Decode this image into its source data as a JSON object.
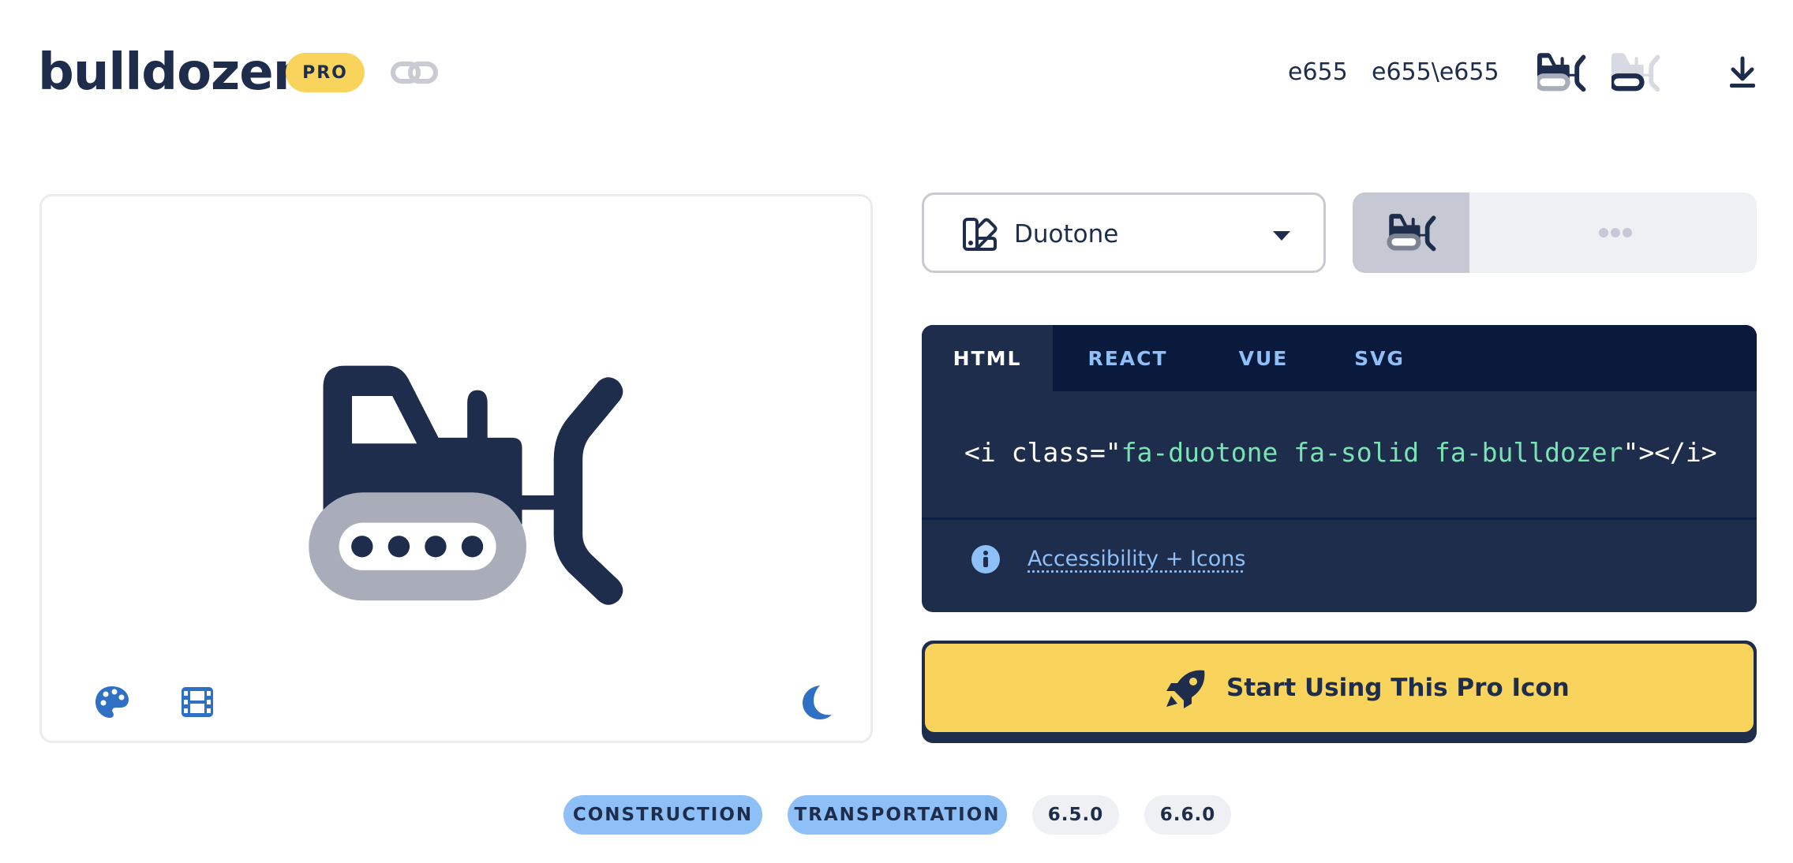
{
  "header": {
    "title": "bulldozer",
    "badge": "PRO",
    "unicode": "e655",
    "unicode_double": "e655\\e655"
  },
  "style_select": {
    "selected": "Duotone"
  },
  "code": {
    "tabs": [
      "HTML",
      "REACT",
      "VUE",
      "SVG"
    ],
    "active_tab": "HTML",
    "prefix": "<i class=\"",
    "classes": "fa-duotone fa-solid fa-bulldozer",
    "suffix": "\"></i>",
    "a11y_link": "Accessibility + Icons"
  },
  "cta": {
    "label": "Start Using This Pro Icon"
  },
  "tags": {
    "categories": [
      "CONSTRUCTION",
      "TRANSPORTATION"
    ],
    "versions": [
      "6.5.0",
      "6.6.0"
    ]
  },
  "icons": [
    "link-icon",
    "bulldozer-icon",
    "bulldozer-outline-icon",
    "download-icon",
    "swatchbook-icon",
    "caret-down-icon",
    "ellipsis-icon",
    "palette-icon",
    "film-icon",
    "moon-icon",
    "info-icon",
    "rocket-icon"
  ],
  "colors": {
    "primary": "#1e2d4b",
    "secondary": "#a9adba",
    "pro": "#f8d45c",
    "accent_blue": "#8ebff7",
    "code_string": "#79e3b4",
    "tool_blue": "#2f6fc4"
  }
}
